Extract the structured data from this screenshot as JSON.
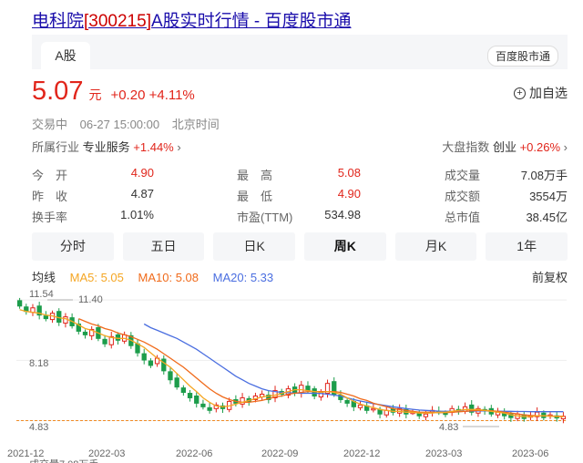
{
  "title": {
    "name": "电科院",
    "code": "[300215]",
    "rest": "A股实时行情 - 百度股市通"
  },
  "tabs": {
    "active": "A股",
    "source": "百度股市通"
  },
  "quote": {
    "price": "5.07",
    "unit": "元",
    "change": "+0.20",
    "change_pct": "+4.11%",
    "add_watch": "加自选",
    "status": "交易中",
    "time": "06-27 15:00:00",
    "tz": "北京时间"
  },
  "industry": {
    "label": "所属行业",
    "name": "专业服务",
    "pct": "+1.44%",
    "index_label": "大盘指数",
    "index_name": "创业",
    "index_pct": "+0.26%"
  },
  "stats": [
    {
      "label": "今　开",
      "value": "4.90",
      "color": "red"
    },
    {
      "label": "最　高",
      "value": "5.08",
      "color": "red"
    },
    {
      "label": "成交量",
      "value": "7.08万手",
      "color": ""
    },
    {
      "label": "昨　收",
      "value": "4.87",
      "color": ""
    },
    {
      "label": "最　低",
      "value": "4.90",
      "color": "red"
    },
    {
      "label": "成交额",
      "value": "3554万",
      "color": ""
    },
    {
      "label": "换手率",
      "value": "1.01%",
      "color": ""
    },
    {
      "label": "市盈(TTM)",
      "value": "534.98",
      "color": ""
    },
    {
      "label": "总市值",
      "value": "38.45亿",
      "color": ""
    }
  ],
  "period_tabs": [
    "分时",
    "五日",
    "日K",
    "周K",
    "月K",
    "1年"
  ],
  "active_period": "周K",
  "ma": {
    "avg": "均线",
    "ma5": "MA5: 5.05",
    "ma10": "MA10: 5.08",
    "ma20": "MA20: 5.33",
    "adjust": "前复权",
    "ma5_color": "#f5a623",
    "ma10_color": "#f06a1a",
    "ma20_color": "#4a6ee0"
  },
  "chart_data": {
    "type": "candlestick",
    "x_ticks": [
      "2021-12",
      "2022-03",
      "2022-06",
      "2022-09",
      "2022-12",
      "2023-03",
      "2023-06"
    ],
    "price_labels": [
      "11.54",
      "11.40",
      "8.18",
      "4.83",
      "4.83"
    ],
    "bottom_text": "成交量7.08万手",
    "up_color": "#e1251b",
    "down_color": "#1c9d4b",
    "closes": [
      11.2,
      10.9,
      11.1,
      10.7,
      10.5,
      10.8,
      10.3,
      10.6,
      10.1,
      9.8,
      9.6,
      9.9,
      9.4,
      9.1,
      9.5,
      9.3,
      9.6,
      9.0,
      8.6,
      8.2,
      7.9,
      8.3,
      7.6,
      7.1,
      6.7,
      6.4,
      6.1,
      5.8,
      5.6,
      5.4,
      5.7,
      5.5,
      5.9,
      5.8,
      6.1,
      5.9,
      6.2,
      6.3,
      6.0,
      6.5,
      6.3,
      6.6,
      6.4,
      6.8,
      6.5,
      6.2,
      6.4,
      6.9,
      6.3,
      6.0,
      5.8,
      5.6,
      5.7,
      5.4,
      5.5,
      5.2,
      5.4,
      5.3,
      5.5,
      5.2,
      5.3,
      5.1,
      5.2,
      5.4,
      5.3,
      5.2,
      5.5,
      5.4,
      5.6,
      5.3,
      5.5,
      5.4,
      5.2,
      5.3,
      5.1,
      5.0,
      5.2,
      4.95,
      5.1,
      5.3,
      5.0,
      5.15,
      4.98,
      5.07
    ],
    "ma5": [
      11.0,
      10.9,
      10.85,
      10.8,
      10.7,
      10.65,
      10.55,
      10.5,
      10.35,
      10.15,
      9.95,
      9.85,
      9.7,
      9.55,
      9.45,
      9.4,
      9.4,
      9.3,
      9.1,
      8.9,
      8.6,
      8.3,
      8.05,
      7.8,
      7.45,
      7.1,
      6.75,
      6.45,
      6.1,
      5.85,
      5.65,
      5.6,
      5.65,
      5.75,
      5.85,
      5.95,
      6.05,
      6.15,
      6.2,
      6.25,
      6.35,
      6.45,
      6.55,
      6.55,
      6.5,
      6.45,
      6.4,
      6.45,
      6.4,
      6.3,
      6.1,
      5.9,
      5.75,
      5.65,
      5.55,
      5.45,
      5.4,
      5.35,
      5.35,
      5.3,
      5.3,
      5.25,
      5.25,
      5.25,
      5.3,
      5.3,
      5.35,
      5.4,
      5.45,
      5.45,
      5.45,
      5.4,
      5.35,
      5.3,
      5.25,
      5.15,
      5.1,
      5.05,
      5.05,
      5.1,
      5.1,
      5.08,
      5.06,
      5.05
    ],
    "ma10": [
      null,
      null,
      null,
      null,
      null,
      null,
      null,
      null,
      null,
      10.5,
      10.35,
      10.2,
      10.1,
      9.95,
      9.85,
      9.7,
      9.6,
      9.5,
      9.35,
      9.2,
      9.0,
      8.8,
      8.55,
      8.3,
      8.05,
      7.8,
      7.5,
      7.2,
      6.9,
      6.6,
      6.35,
      6.15,
      6.0,
      5.9,
      5.85,
      5.85,
      5.9,
      5.95,
      6.05,
      6.15,
      6.2,
      6.3,
      6.35,
      6.4,
      6.45,
      6.45,
      6.45,
      6.45,
      6.45,
      6.4,
      6.3,
      6.2,
      6.05,
      5.95,
      5.8,
      5.7,
      5.6,
      5.5,
      5.45,
      5.4,
      5.35,
      5.3,
      5.3,
      5.3,
      5.28,
      5.28,
      5.3,
      5.32,
      5.35,
      5.38,
      5.4,
      5.4,
      5.38,
      5.35,
      5.3,
      5.25,
      5.2,
      5.15,
      5.12,
      5.1,
      5.1,
      5.09,
      5.08,
      5.08
    ],
    "ma20": [
      null,
      null,
      null,
      null,
      null,
      null,
      null,
      null,
      null,
      null,
      null,
      null,
      null,
      null,
      null,
      null,
      null,
      null,
      null,
      10.2,
      10.0,
      9.85,
      9.7,
      9.55,
      9.4,
      9.2,
      9.0,
      8.8,
      8.55,
      8.3,
      8.05,
      7.8,
      7.55,
      7.3,
      7.1,
      6.9,
      6.75,
      6.6,
      6.5,
      6.45,
      6.4,
      6.38,
      6.36,
      6.35,
      6.35,
      6.35,
      6.34,
      6.3,
      6.25,
      6.2,
      6.1,
      6.0,
      5.92,
      5.85,
      5.78,
      5.72,
      5.66,
      5.6,
      5.55,
      5.5,
      5.46,
      5.42,
      5.4,
      5.38,
      5.36,
      5.35,
      5.35,
      5.35,
      5.36,
      5.36,
      5.37,
      5.37,
      5.36,
      5.36,
      5.35,
      5.35,
      5.34,
      5.34,
      5.33,
      5.33,
      5.33,
      5.33,
      5.33,
      5.33
    ]
  }
}
